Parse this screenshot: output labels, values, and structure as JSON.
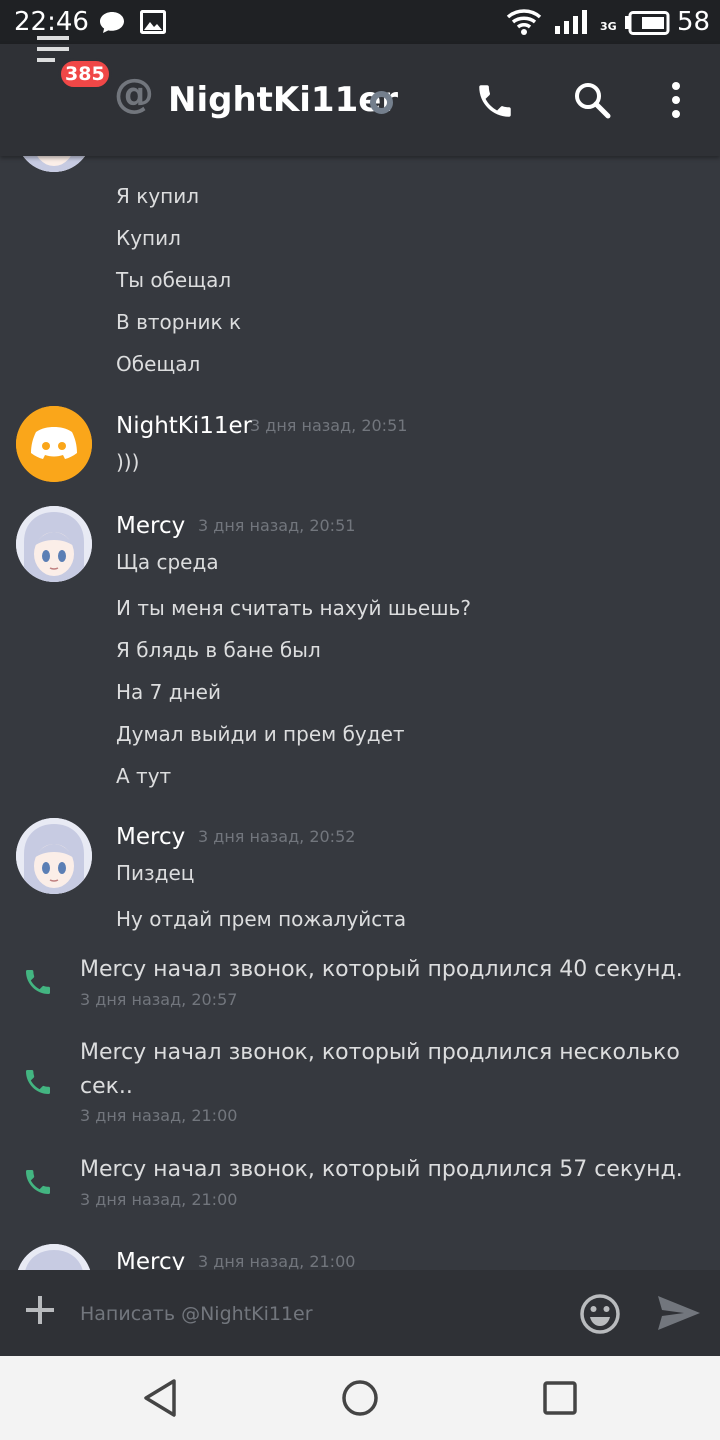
{
  "status_bar": {
    "time": "22:46",
    "network": "3G",
    "battery": "58",
    "icons": [
      "chat-bubble-icon",
      "image-icon",
      "wifi-icon",
      "signal-icon",
      "battery-icon"
    ]
  },
  "header": {
    "unread_badge": "385",
    "at_symbol": "@",
    "title": "NightKi11er",
    "icons": [
      "menu-icon",
      "phone-icon",
      "search-icon",
      "more-vertical-icon"
    ]
  },
  "messages": {
    "group0_lines": [
      "Я купил",
      "Купил",
      "Ты обещал",
      "В вторник к",
      "Обещал"
    ],
    "group1": {
      "username": "NightKi11er",
      "timestamp": "3 дня назад, 20:51",
      "lines": [
        ")))"
      ]
    },
    "group2": {
      "username": "Mercy",
      "timestamp": "3 дня назад, 20:51",
      "lines": [
        "Ща среда",
        "И ты меня считать нахуй шьешь?",
        "Я блядь в бане был",
        "На 7 дней",
        "Думал выйди и прем будет",
        "А тут"
      ]
    },
    "group3": {
      "username": "Mercy",
      "timestamp": "3 дня назад, 20:52",
      "lines": [
        "Пиздец",
        "Ну отдай прем пожалуйста"
      ]
    },
    "calls": [
      {
        "text": "Mercy начал звонок, который продлился 40 секунд.",
        "timestamp": "3 дня назад, 20:57"
      },
      {
        "text": "Mercy начал звонок, который продлился несколько сек..",
        "timestamp": "3 дня назад, 21:00"
      },
      {
        "text": "Mercy начал звонок, который продлился 57 секунд.",
        "timestamp": "3 дня назад, 21:00"
      }
    ],
    "group4": {
      "username": "Mercy",
      "timestamp": "3 дня назад, 21:00"
    }
  },
  "composer": {
    "placeholder": "Написать @NightKi11er",
    "icons": [
      "plus-icon",
      "emoji-icon",
      "send-icon"
    ]
  },
  "colors": {
    "background": "#36393f",
    "header": "#2f3136",
    "badge": "#f04747",
    "call_green": "#43b581",
    "discord_avatar": "#faa61a"
  }
}
